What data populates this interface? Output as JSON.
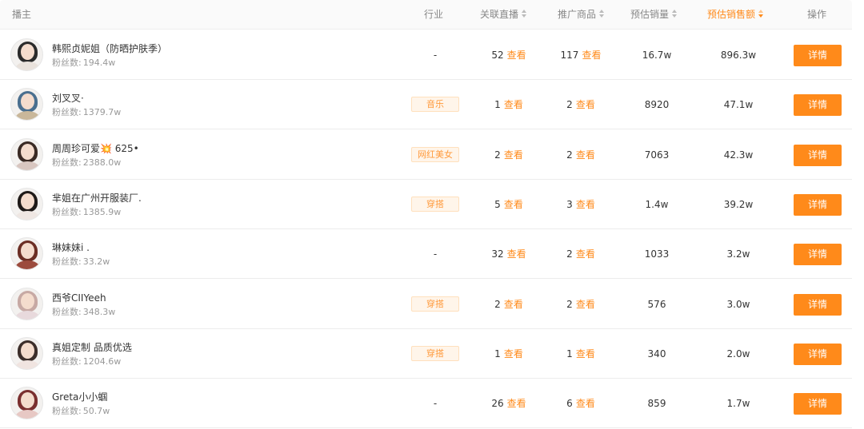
{
  "header": {
    "anchor": "播主",
    "industry": "行业",
    "live": "关联直播",
    "goods": "推广商品",
    "sales": "预估销量",
    "revenue": "预估销售额",
    "action": "操作"
  },
  "colors": {
    "accent": "#ff8a1a",
    "tag_bg": "#fff5ea"
  },
  "fans_label": "粉丝数:",
  "view_label": "查看",
  "detail_label": "详情",
  "rows": [
    {
      "name": "韩熙贞妮姐（防晒护肤季）",
      "fans": "194.4w",
      "industry": "-",
      "live": "52",
      "goods": "117",
      "sales": "16.7w",
      "revenue": "896.3w"
    },
    {
      "name": "刘叉叉·",
      "fans": "1379.7w",
      "industry": "音乐",
      "live": "1",
      "goods": "2",
      "sales": "8920",
      "revenue": "47.1w"
    },
    {
      "name": "周周珍可爱💥 625•",
      "fans": "2388.0w",
      "industry": "网红美女",
      "live": "2",
      "goods": "2",
      "sales": "7063",
      "revenue": "42.3w"
    },
    {
      "name": "芈姐在广州开服装厂.",
      "fans": "1385.9w",
      "industry": "穿搭",
      "live": "5",
      "goods": "3",
      "sales": "1.4w",
      "revenue": "39.2w"
    },
    {
      "name": "琳妹妹i .",
      "fans": "33.2w",
      "industry": "-",
      "live": "32",
      "goods": "2",
      "sales": "1033",
      "revenue": "3.2w"
    },
    {
      "name": "西爷CIIYeeh",
      "fans": "348.3w",
      "industry": "穿搭",
      "live": "2",
      "goods": "2",
      "sales": "576",
      "revenue": "3.0w"
    },
    {
      "name": "真姐定制 品质优选",
      "fans": "1204.6w",
      "industry": "穿搭",
      "live": "1",
      "goods": "1",
      "sales": "340",
      "revenue": "2.0w"
    },
    {
      "name": "Greta小小蝈",
      "fans": "50.7w",
      "industry": "-",
      "live": "26",
      "goods": "6",
      "sales": "859",
      "revenue": "1.7w"
    }
  ]
}
